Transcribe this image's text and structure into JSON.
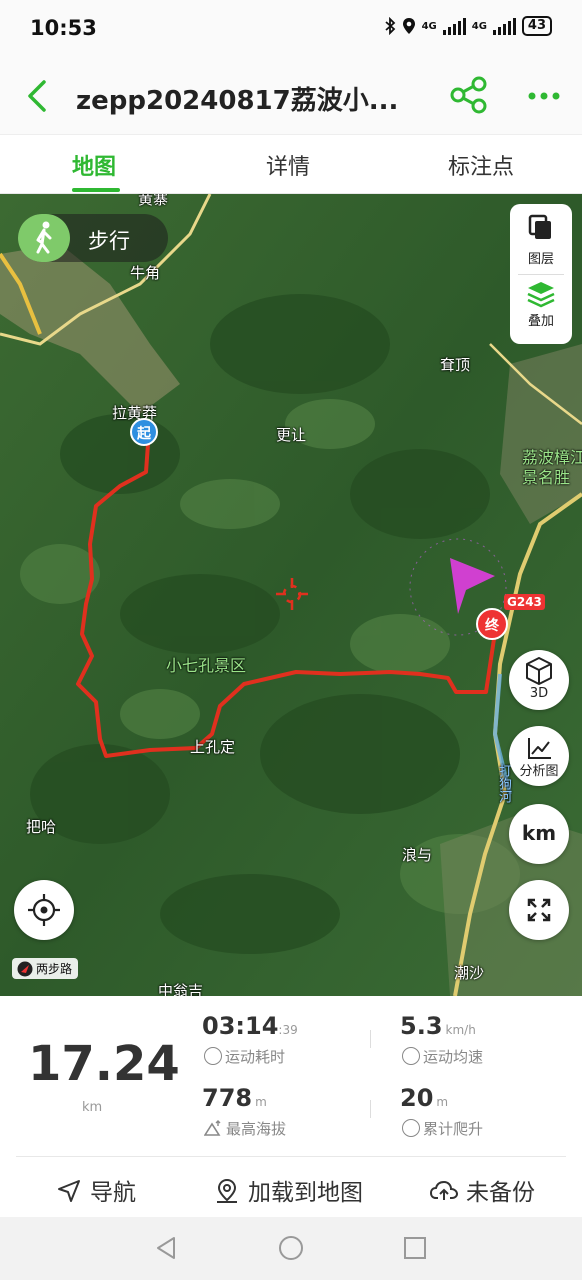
{
  "status_bar": {
    "time": "10:53",
    "battery": "43",
    "network_1": "4G",
    "network_2": "4G"
  },
  "header": {
    "title": "zepp20240817荔波小...",
    "back_icon": "chevron-left-icon",
    "share_icon": "share-icon",
    "more_icon": "more-icon"
  },
  "tabs": [
    {
      "label": "地图",
      "active": true
    },
    {
      "label": "详情",
      "active": false
    },
    {
      "label": "标注点",
      "active": false
    }
  ],
  "map": {
    "mode_label": "步行",
    "layers": {
      "layer_label": "图层",
      "overlay_label": "叠加"
    },
    "labels": {
      "huangzhai": "黄寨",
      "niujiao": "牛角",
      "lahuangmang": "拉黄莽",
      "gengrang": "更让",
      "kangding": "耷顶",
      "libo_scenic": "荔波樟江景名胜",
      "xiaoqikong": "小七孔景区",
      "shangkongding": "上孔定",
      "baha": "把哈",
      "langyu": "浪与",
      "chaosha": "潮沙",
      "zhongwengji": "中翁吉",
      "dagou_river": "打狗河"
    },
    "start_marker": "起",
    "end_marker": "终",
    "road_sign": "G243",
    "btn_3d": "3D",
    "btn_analysis": "分析图",
    "btn_unit": "km",
    "logo_text": "两步路",
    "accent": "#2fb832",
    "track_color": "#e0301e"
  },
  "stats": {
    "distance": "17.24",
    "distance_unit": "km",
    "duration": "03:14",
    "duration_seconds": ":39",
    "duration_label": "运动耗时",
    "avg_speed": "5.3",
    "avg_speed_unit": "km/h",
    "avg_speed_label": "运动均速",
    "max_alt": "778",
    "max_alt_unit": "m",
    "max_alt_label": "最高海拔",
    "climb": "20",
    "climb_unit": "m",
    "climb_label": "累计爬升"
  },
  "actions": {
    "navigate": "导航",
    "load_to_map": "加载到地图",
    "backup": "未备份"
  }
}
